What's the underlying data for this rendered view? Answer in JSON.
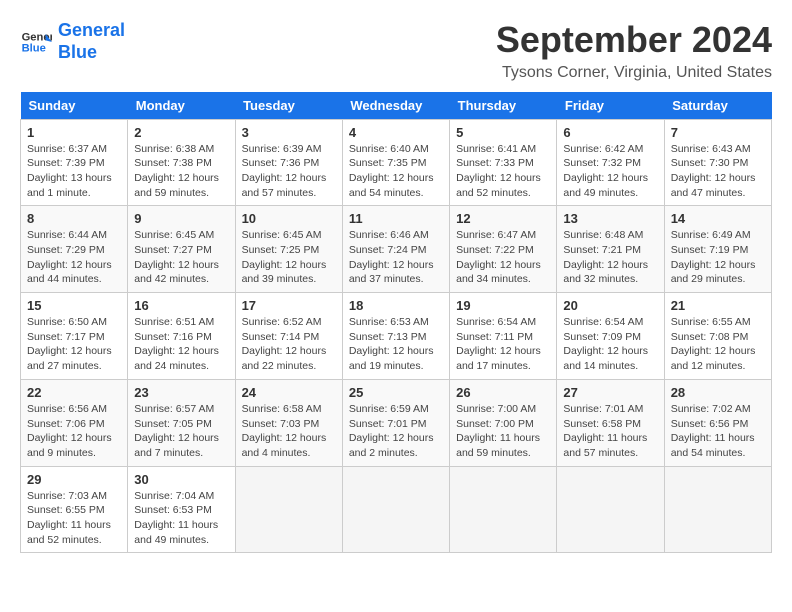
{
  "header": {
    "logo_line1": "General",
    "logo_line2": "Blue",
    "month_title": "September 2024",
    "location": "Tysons Corner, Virginia, United States"
  },
  "days_of_week": [
    "Sunday",
    "Monday",
    "Tuesday",
    "Wednesday",
    "Thursday",
    "Friday",
    "Saturday"
  ],
  "weeks": [
    [
      {
        "day": 1,
        "sunrise": "6:37 AM",
        "sunset": "7:39 PM",
        "daylight": "13 hours and 1 minute."
      },
      {
        "day": 2,
        "sunrise": "6:38 AM",
        "sunset": "7:38 PM",
        "daylight": "12 hours and 59 minutes."
      },
      {
        "day": 3,
        "sunrise": "6:39 AM",
        "sunset": "7:36 PM",
        "daylight": "12 hours and 57 minutes."
      },
      {
        "day": 4,
        "sunrise": "6:40 AM",
        "sunset": "7:35 PM",
        "daylight": "12 hours and 54 minutes."
      },
      {
        "day": 5,
        "sunrise": "6:41 AM",
        "sunset": "7:33 PM",
        "daylight": "12 hours and 52 minutes."
      },
      {
        "day": 6,
        "sunrise": "6:42 AM",
        "sunset": "7:32 PM",
        "daylight": "12 hours and 49 minutes."
      },
      {
        "day": 7,
        "sunrise": "6:43 AM",
        "sunset": "7:30 PM",
        "daylight": "12 hours and 47 minutes."
      }
    ],
    [
      {
        "day": 8,
        "sunrise": "6:44 AM",
        "sunset": "7:29 PM",
        "daylight": "12 hours and 44 minutes."
      },
      {
        "day": 9,
        "sunrise": "6:45 AM",
        "sunset": "7:27 PM",
        "daylight": "12 hours and 42 minutes."
      },
      {
        "day": 10,
        "sunrise": "6:45 AM",
        "sunset": "7:25 PM",
        "daylight": "12 hours and 39 minutes."
      },
      {
        "day": 11,
        "sunrise": "6:46 AM",
        "sunset": "7:24 PM",
        "daylight": "12 hours and 37 minutes."
      },
      {
        "day": 12,
        "sunrise": "6:47 AM",
        "sunset": "7:22 PM",
        "daylight": "12 hours and 34 minutes."
      },
      {
        "day": 13,
        "sunrise": "6:48 AM",
        "sunset": "7:21 PM",
        "daylight": "12 hours and 32 minutes."
      },
      {
        "day": 14,
        "sunrise": "6:49 AM",
        "sunset": "7:19 PM",
        "daylight": "12 hours and 29 minutes."
      }
    ],
    [
      {
        "day": 15,
        "sunrise": "6:50 AM",
        "sunset": "7:17 PM",
        "daylight": "12 hours and 27 minutes."
      },
      {
        "day": 16,
        "sunrise": "6:51 AM",
        "sunset": "7:16 PM",
        "daylight": "12 hours and 24 minutes."
      },
      {
        "day": 17,
        "sunrise": "6:52 AM",
        "sunset": "7:14 PM",
        "daylight": "12 hours and 22 minutes."
      },
      {
        "day": 18,
        "sunrise": "6:53 AM",
        "sunset": "7:13 PM",
        "daylight": "12 hours and 19 minutes."
      },
      {
        "day": 19,
        "sunrise": "6:54 AM",
        "sunset": "7:11 PM",
        "daylight": "12 hours and 17 minutes."
      },
      {
        "day": 20,
        "sunrise": "6:54 AM",
        "sunset": "7:09 PM",
        "daylight": "12 hours and 14 minutes."
      },
      {
        "day": 21,
        "sunrise": "6:55 AM",
        "sunset": "7:08 PM",
        "daylight": "12 hours and 12 minutes."
      }
    ],
    [
      {
        "day": 22,
        "sunrise": "6:56 AM",
        "sunset": "7:06 PM",
        "daylight": "12 hours and 9 minutes."
      },
      {
        "day": 23,
        "sunrise": "6:57 AM",
        "sunset": "7:05 PM",
        "daylight": "12 hours and 7 minutes."
      },
      {
        "day": 24,
        "sunrise": "6:58 AM",
        "sunset": "7:03 PM",
        "daylight": "12 hours and 4 minutes."
      },
      {
        "day": 25,
        "sunrise": "6:59 AM",
        "sunset": "7:01 PM",
        "daylight": "12 hours and 2 minutes."
      },
      {
        "day": 26,
        "sunrise": "7:00 AM",
        "sunset": "7:00 PM",
        "daylight": "11 hours and 59 minutes."
      },
      {
        "day": 27,
        "sunrise": "7:01 AM",
        "sunset": "6:58 PM",
        "daylight": "11 hours and 57 minutes."
      },
      {
        "day": 28,
        "sunrise": "7:02 AM",
        "sunset": "6:56 PM",
        "daylight": "11 hours and 54 minutes."
      }
    ],
    [
      {
        "day": 29,
        "sunrise": "7:03 AM",
        "sunset": "6:55 PM",
        "daylight": "11 hours and 52 minutes."
      },
      {
        "day": 30,
        "sunrise": "7:04 AM",
        "sunset": "6:53 PM",
        "daylight": "11 hours and 49 minutes."
      },
      null,
      null,
      null,
      null,
      null
    ]
  ],
  "labels": {
    "sunrise": "Sunrise:",
    "sunset": "Sunset:",
    "daylight": "Daylight:"
  }
}
